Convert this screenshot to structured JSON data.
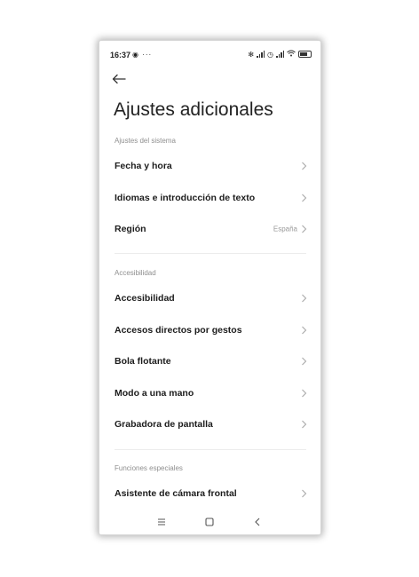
{
  "status_bar": {
    "time": "16:37",
    "left_icons": [
      "whatsapp-icon",
      "more-dots-icon"
    ],
    "right_icons": [
      "bluetooth-icon",
      "signal-icon",
      "alarm-icon",
      "signal-icon",
      "wifi-icon",
      "battery-icon"
    ]
  },
  "header": {
    "back_icon": "arrow-left-icon",
    "title": "Ajustes adicionales"
  },
  "sections": [
    {
      "label": "Ajustes del sistema",
      "items": [
        {
          "label": "Fecha y hora",
          "value": ""
        },
        {
          "label": "Idiomas e introducción de texto",
          "value": ""
        },
        {
          "label": "Región",
          "value": "España"
        }
      ]
    },
    {
      "label": "Accesibilidad",
      "items": [
        {
          "label": "Accesibilidad",
          "value": ""
        },
        {
          "label": "Accesos directos por gestos",
          "value": ""
        },
        {
          "label": "Bola flotante",
          "value": ""
        },
        {
          "label": "Modo a una mano",
          "value": ""
        },
        {
          "label": "Grabadora de pantalla",
          "value": ""
        }
      ]
    },
    {
      "label": "Funciones especiales",
      "items": [
        {
          "label": "Asistente de cámara frontal",
          "value": ""
        }
      ]
    }
  ],
  "nav_bar": {
    "buttons": [
      "menu-icon",
      "home-icon",
      "back-icon"
    ]
  }
}
